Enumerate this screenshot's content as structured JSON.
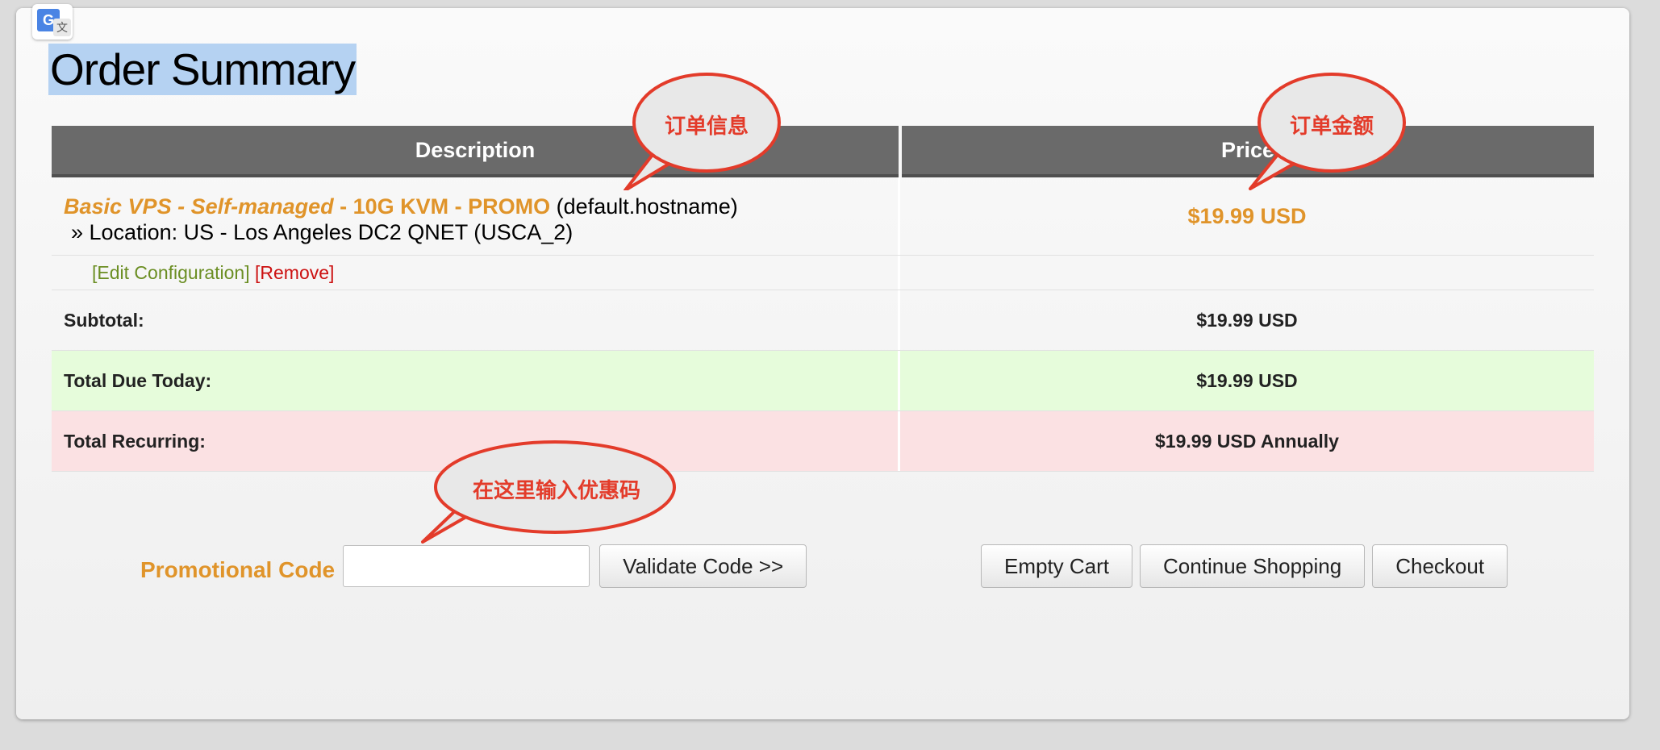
{
  "page": {
    "title": "Order Summary",
    "translate_badge": {
      "g": "G",
      "wen": "文"
    }
  },
  "table": {
    "headers": {
      "description": "Description",
      "price": "Price"
    },
    "product": {
      "name_italic": "Basic VPS - Self-managed",
      "name_sep": " - ",
      "name_plain": "10G KVM - PROMO",
      "hostname": "(default.hostname)",
      "location": "» Location: US - Los Angeles DC2 QNET (USCA_2)",
      "price": "$19.99 USD"
    },
    "actions": {
      "edit": "[Edit Configuration]",
      "remove": "[Remove]"
    },
    "subtotal": {
      "label": "Subtotal:",
      "value": "$19.99 USD"
    },
    "total_due": {
      "label": "Total Due Today:",
      "value": "$19.99 USD"
    },
    "total_recurring": {
      "label": "Total Recurring:",
      "value": "$19.99 USD Annually"
    }
  },
  "promo": {
    "label": "Promotional Code",
    "input_value": "",
    "input_placeholder": "",
    "validate_button": "Validate Code >>"
  },
  "cart_buttons": {
    "empty_cart": "Empty Cart",
    "continue_shopping": "Continue Shopping",
    "checkout": "Checkout"
  },
  "annotations": {
    "order_info": "订单信息",
    "order_amount": "订单金额",
    "promo_hint": "在这里输入优惠码"
  },
  "colors": {
    "header_bg": "#6a6a6a",
    "accent_orange": "#e0942a",
    "edit_green": "#6b8e23",
    "remove_red": "#cc1111",
    "total_due_bg": "#e6fcdb",
    "total_recurring_bg": "#fbe1e3",
    "annotation_red": "#e33b2a"
  }
}
